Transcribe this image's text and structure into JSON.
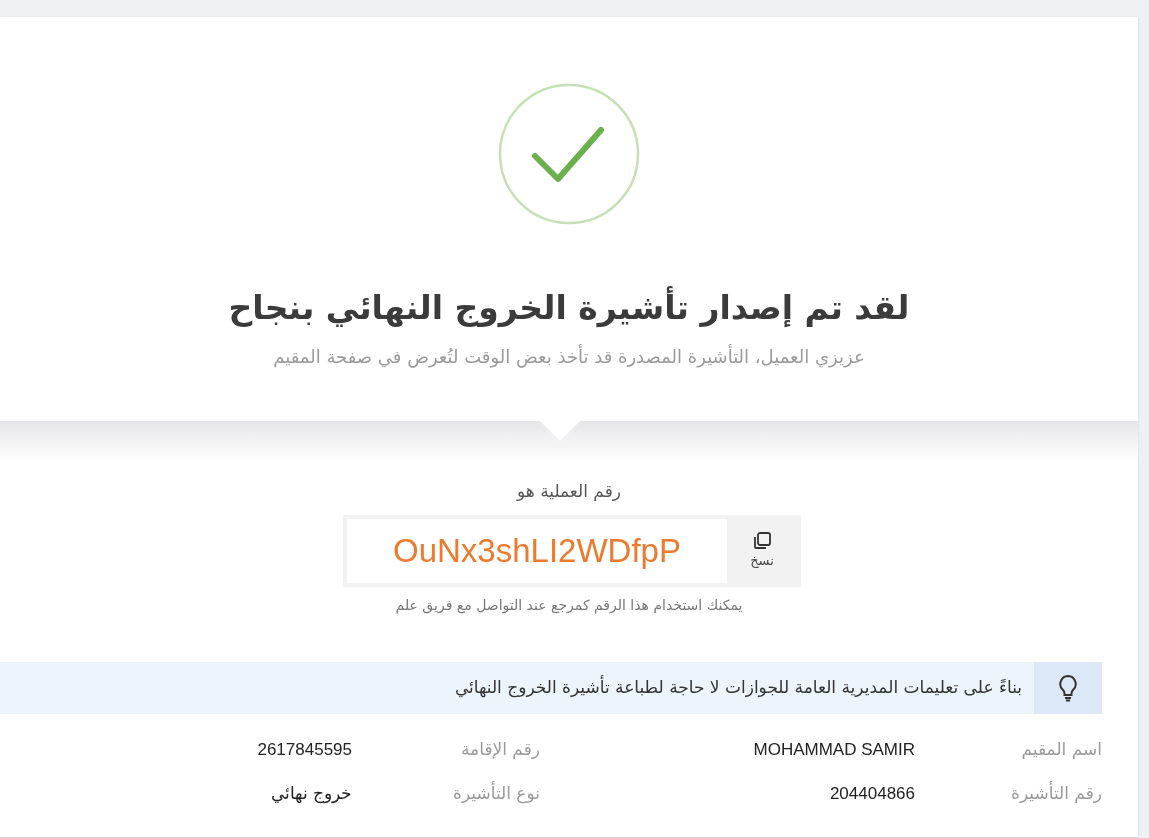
{
  "success": {
    "title": "لقد تم إصدار تأشيرة الخروج النهائي بنجاح",
    "subtitle": "عزيزي العميل، التأشيرة المصدرة قد تأخذ بعض الوقت لتُعرض في صفحة المقيم"
  },
  "transaction": {
    "label": "رقم العملية هو",
    "number": "OuNx3shLI2WDfpP",
    "copy_label": "نسخ",
    "hint": "يمكنك استخدام هذا الرقم كمرجع عند التواصل مع فريق علم"
  },
  "notice": "بناءً على تعليمات المديرية العامة للجوازات لا حاجة لطباعة تأشيرة الخروج النهائي",
  "details": [
    {
      "label": "اسم المقيم",
      "value": "MOHAMMAD SAMIR"
    },
    {
      "label": "رقم الإقامة",
      "value": "2617845595"
    },
    {
      "label": "رقم التأشيرة",
      "value": "204404866"
    },
    {
      "label": "نوع التأشيرة",
      "value": "خروج نهائي"
    }
  ]
}
